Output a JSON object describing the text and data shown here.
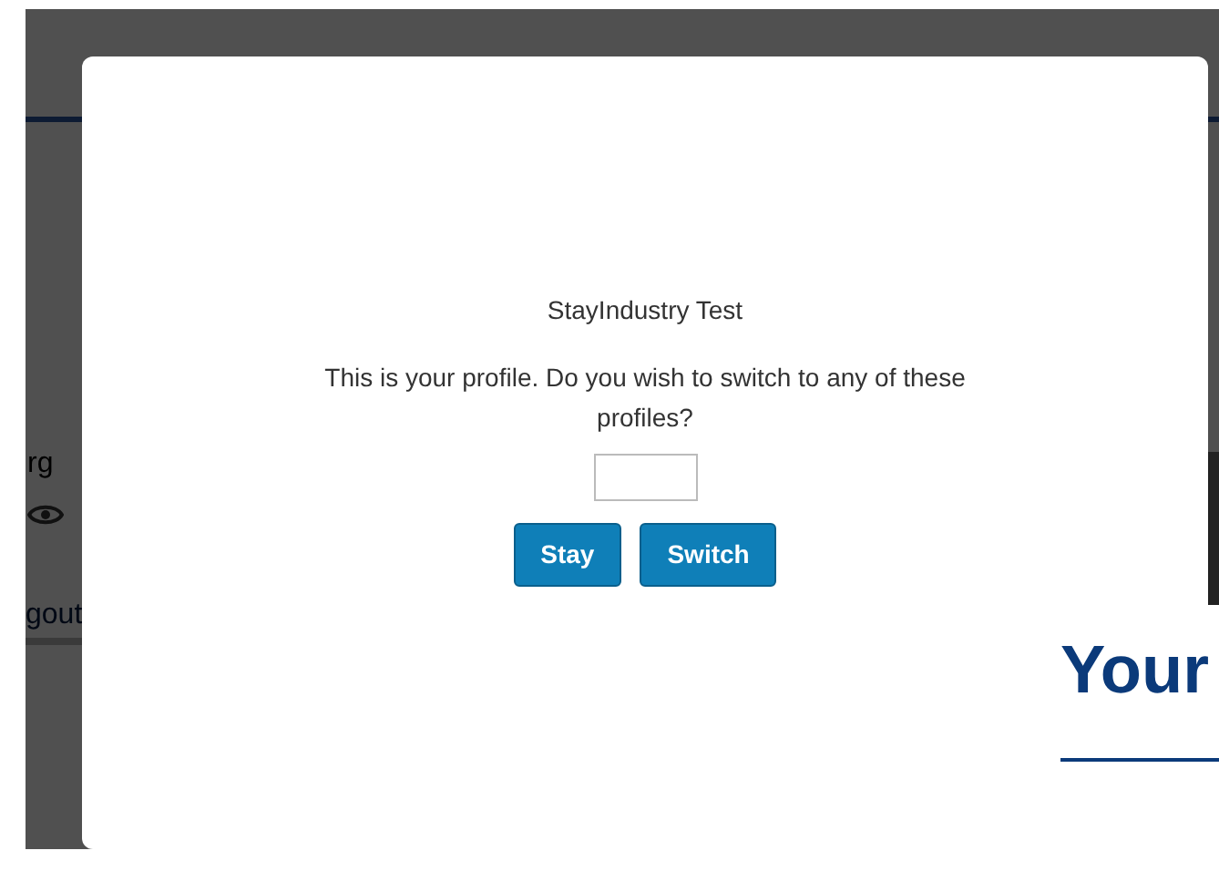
{
  "background": {
    "org_text": "rg",
    "logout_link": "gout",
    "heading": "Your"
  },
  "dialog": {
    "title": "StayIndustry Test",
    "message": "This is your profile. Do you wish to switch to any of these profiles?",
    "buttons": [
      {
        "label": "Stay"
      },
      {
        "label": "Switch"
      }
    ]
  }
}
